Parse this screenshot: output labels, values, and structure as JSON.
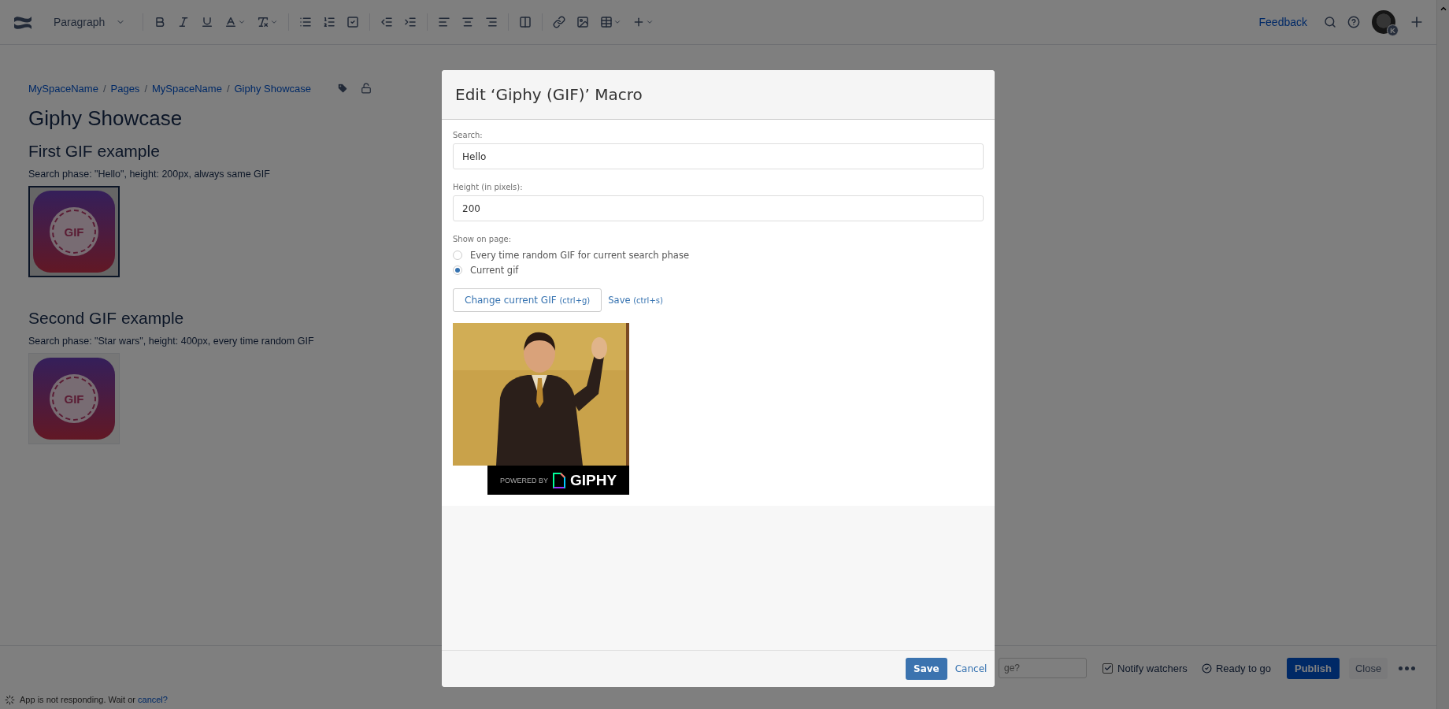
{
  "toolbar": {
    "paragraph_style": "Paragraph",
    "feedback": "Feedback",
    "avatar_badge": "K"
  },
  "breadcrumbs": [
    {
      "label": "MySpaceName"
    },
    {
      "separator": "/",
      "label": "Pages"
    },
    {
      "separator": "/",
      "label": "MySpaceName"
    },
    {
      "separator": "/",
      "label": "Giphy Showcase"
    }
  ],
  "page_title": "Giphy Showcase",
  "sections": [
    {
      "heading": "First GIF example",
      "description": "Search phase: \"Hello\", height: 200px, always same GIF",
      "gif": {
        "label": "GIF",
        "selected": true
      }
    },
    {
      "heading": "Second GIF example",
      "description": "Search phase: \"Star wars\", height: 400px, every time random GIF",
      "gif": {
        "label": "GIF",
        "selected": false
      }
    }
  ],
  "bottom_bar": {
    "field_placeholder": "ge?",
    "notify_watchers": {
      "label": "Notify watchers",
      "checked": true
    },
    "status": "Ready to go",
    "publish": "Publish",
    "close": "Close"
  },
  "status_line": {
    "text": "App is not responding. Wait or ",
    "link": "cancel?"
  },
  "dialog": {
    "title": "Edit ‘Giphy (GIF)’ Macro",
    "fields": [
      {
        "label": "Search:",
        "value": "Hello"
      },
      {
        "label": "Height (in pixels):",
        "value": "200"
      }
    ],
    "show_on_page": {
      "label": "Show on page:",
      "options": [
        {
          "label": "Every time random GIF for current search phase",
          "selected": false
        },
        {
          "label": "Current gif",
          "selected": true
        }
      ]
    },
    "change_button": {
      "label": "Change current GIF",
      "shortcut": "(ctrl+g)"
    },
    "save_link": {
      "label": "Save",
      "shortcut": "(ctrl+s)"
    },
    "giphy_badge": {
      "prefix": "POWERED BY",
      "brand": "GIPHY"
    },
    "footer": {
      "save": "Save",
      "cancel": "Cancel"
    }
  }
}
